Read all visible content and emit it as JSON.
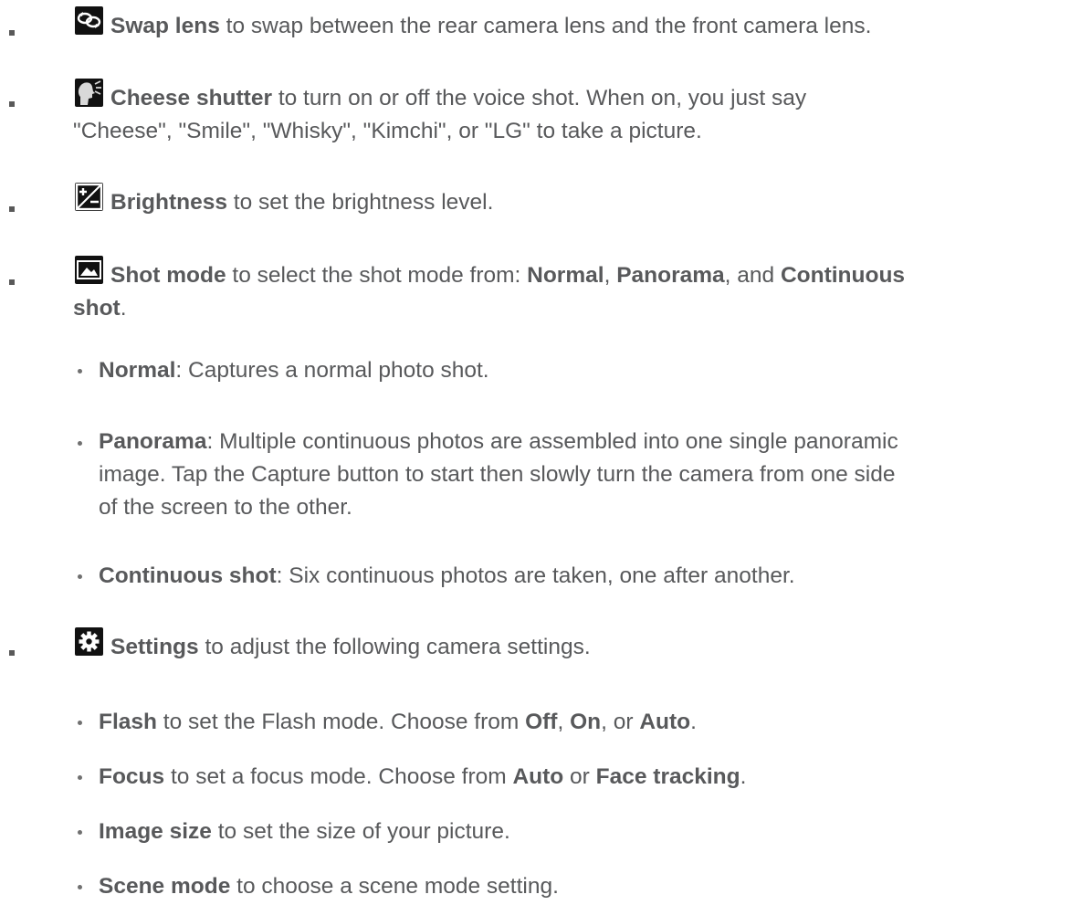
{
  "items": [
    {
      "icon": "swap-lens-icon",
      "term": "Swap lens",
      "text": " to swap between the rear camera lens and the front camera lens."
    },
    {
      "icon": "cheese-shutter-icon",
      "term": "Cheese shutter",
      "text_line1": " to turn on or off the voice shot. When on, you just say",
      "text_line2": "\"Cheese\", \"Smile\", \"Whisky\", \"Kimchi\", or \"LG\" to take a picture."
    },
    {
      "icon": "brightness-icon",
      "term": "Brightness",
      "text": " to set the brightness level."
    },
    {
      "icon": "shot-mode-icon",
      "term": "Shot mode",
      "text_a": " to select the shot mode from: ",
      "opt1": "Normal",
      "sep1": ", ",
      "opt2": "Panorama",
      "sep2": ", and ",
      "opt3a": "Continuous",
      "opt3b": "shot",
      "end": ".",
      "sub": [
        {
          "term": "Normal",
          "text": ": Captures a normal photo shot."
        },
        {
          "term": "Panorama",
          "text_line1": ": Multiple continuous photos are assembled into one single panoramic",
          "text_line2": "image. Tap the Capture button to start then slowly turn the camera from one side",
          "text_line3": "of the screen to the other."
        },
        {
          "term": "Continuous shot",
          "text": ": Six continuous photos are taken, one after another."
        }
      ]
    },
    {
      "icon": "settings-gear-icon",
      "term": "Settings",
      "text": " to adjust the following camera settings.",
      "sub": [
        {
          "term": "Flash",
          "text_a": " to set the Flash mode. Choose from ",
          "o1": "Off",
          "s1": ", ",
          "o2": "On",
          "s2": ", or ",
          "o3": "Auto",
          "end": "."
        },
        {
          "term": "Focus",
          "text_a": " to set a focus mode. Choose from ",
          "o1": "Auto",
          "s1": " or ",
          "o2": "Face tracking",
          "end": "."
        },
        {
          "term": "Image size",
          "text": " to set the size of your picture."
        },
        {
          "term": "Scene mode",
          "text": " to choose a scene mode setting."
        }
      ]
    }
  ]
}
